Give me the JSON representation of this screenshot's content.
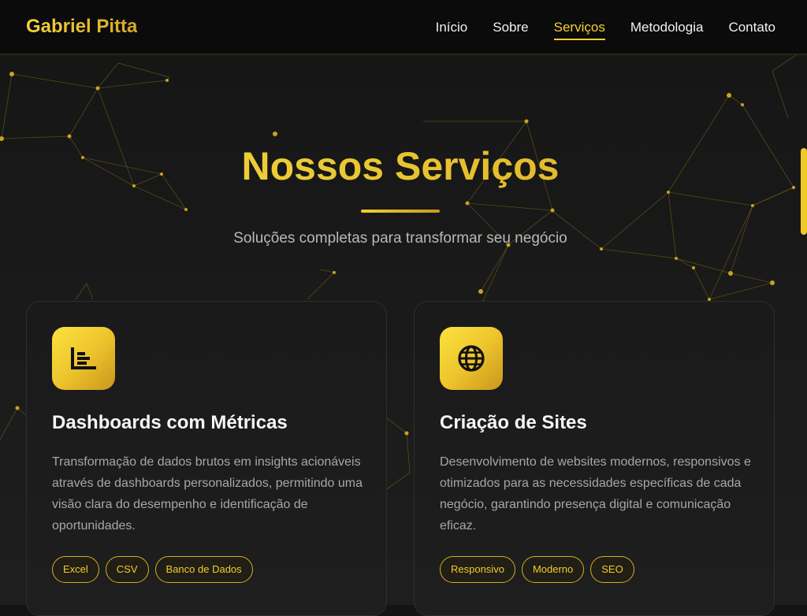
{
  "header": {
    "brand": "Gabriel Pitta",
    "nav": [
      {
        "label": "Início"
      },
      {
        "label": "Sobre"
      },
      {
        "label": "Serviços",
        "active": true
      },
      {
        "label": "Metodologia"
      },
      {
        "label": "Contato"
      }
    ]
  },
  "hero": {
    "title": "Nossos Serviços",
    "subtitle": "Soluções completas para transformar seu negócio"
  },
  "services": [
    {
      "icon": "chart-icon",
      "title": "Dashboards com Métricas",
      "description": "Transformação de dados brutos em insights acionáveis através de dashboards personalizados, permitindo uma visão clara do desempenho e identificação de oportunidades.",
      "tags": [
        "Excel",
        "CSV",
        "Banco de Dados"
      ]
    },
    {
      "icon": "globe-icon",
      "title": "Criação de Sites",
      "description": "Desenvolvimento de websites modernos, responsivos e otimizados para as necessidades específicas de cada negócio, garantindo presença digital e comunicação eficaz.",
      "tags": [
        "Responsivo",
        "Moderno",
        "SEO"
      ]
    }
  ],
  "colors": {
    "accent": "#f6cf2e",
    "background": "#141414",
    "card": "#1c1c1c"
  }
}
